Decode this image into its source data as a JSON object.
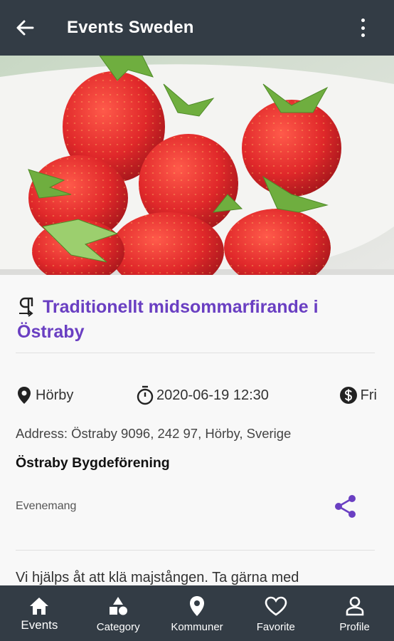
{
  "app_bar": {
    "title": "Events Sweden",
    "back_icon": "arrow-left-icon",
    "menu_icon": "more-vertical-icon"
  },
  "hero": {
    "image_alt": "Strawberries in a white bowl"
  },
  "event": {
    "title_line1": "Traditionellt midsommarfirande i",
    "title_line2": "Östraby",
    "municipality": "Hörby",
    "datetime": "2020-06-19 12:30",
    "price": "Fri",
    "address": "Address: Östraby 9096, 242 97, Hörby, Sverige",
    "organizer": "Östraby Bygdeförening",
    "category": "Evenemang",
    "description": "Vi hjälps åt att klä majstången. Ta gärna med"
  },
  "bottom_nav": {
    "items": [
      {
        "label": "Events",
        "icon": "home-icon",
        "active": true
      },
      {
        "label": "Category",
        "icon": "shapes-icon",
        "active": false
      },
      {
        "label": "Kommuner",
        "icon": "map-pin-icon",
        "active": false
      },
      {
        "label": "Favorite",
        "icon": "heart-icon",
        "active": false
      },
      {
        "label": "Profile",
        "icon": "person-icon",
        "active": false
      }
    ]
  },
  "colors": {
    "bar_background": "#333c45",
    "accent": "#6a3fc2",
    "page_background": "#f8f8f8"
  }
}
